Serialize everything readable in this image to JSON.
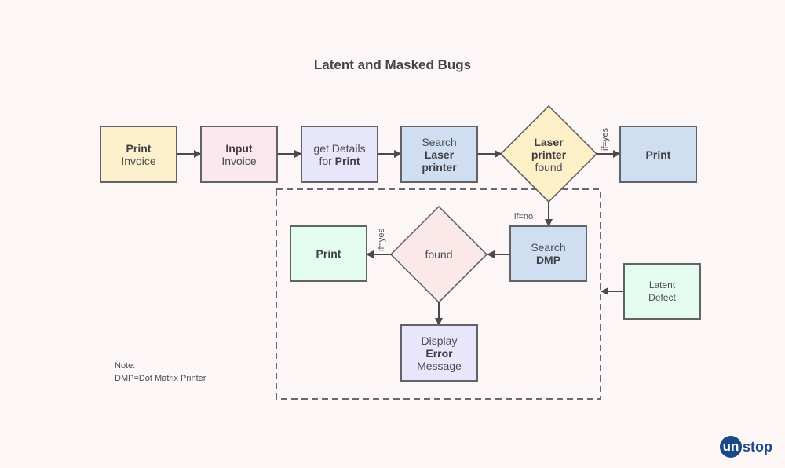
{
  "title": "Latent and Masked Bugs",
  "nodes": {
    "print_invoice": {
      "line1": "Print",
      "line2": "Invoice",
      "color": "#fcf1cc"
    },
    "input_invoice": {
      "line1": "Input",
      "line2": "Invoice",
      "color": "#fbe7ee"
    },
    "get_details": {
      "line1": "get Details",
      "line2a": "for ",
      "line2b": "Print",
      "color": "#e8e6fb"
    },
    "search_laser": {
      "line1": "Search",
      "line2": "Laser",
      "line3": "printer",
      "color": "#cfdff1"
    },
    "laser_found": {
      "line1": "Laser",
      "line2": "printer",
      "line3": "found",
      "color": "#fdf0c8"
    },
    "print_top": {
      "label": "Print",
      "color": "#cfdff1"
    },
    "search_dmp": {
      "line1": "Search",
      "line2": "DMP",
      "color": "#cfdff1"
    },
    "found": {
      "label": "found",
      "color": "#fbe9ea"
    },
    "print_inner": {
      "label": "Print",
      "color": "#e3fcef"
    },
    "display_error": {
      "line1": "Display",
      "line2": "Error",
      "line3": "Message",
      "color": "#e8e6fb"
    },
    "latent_defect": {
      "line1": "Latent",
      "line2": "Defect",
      "color": "#e3fcef"
    }
  },
  "edge_labels": {
    "yes_top": "if=yes",
    "no": "if=no",
    "yes_inner": "if=yes"
  },
  "note": {
    "line1": "Note:",
    "line2": "DMP=Dot Matrix Printer"
  },
  "logo": {
    "circle_text": "un",
    "rest_text": "stop"
  }
}
